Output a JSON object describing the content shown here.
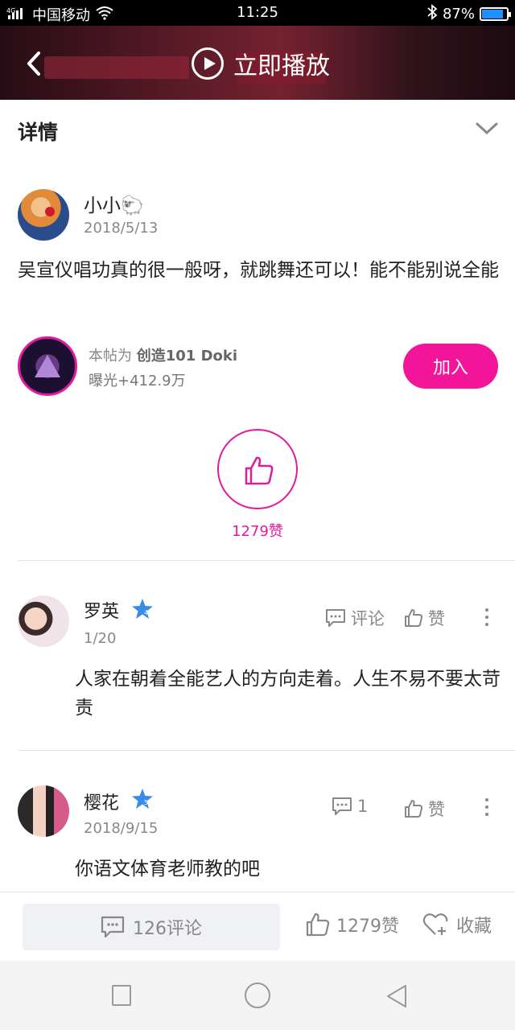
{
  "status_bar": {
    "carrier": "中国移动",
    "network": "4G",
    "time": "11:25",
    "battery": "87%",
    "battery_level": 0.87
  },
  "video": {
    "play_label": "立即播放"
  },
  "detail": {
    "title": "详情"
  },
  "post": {
    "author": "小小🐑",
    "date": "2018/5/13",
    "text": "吴宣仪唱功真的很一般呀，就跳舞还可以！能不能别说全能"
  },
  "community": {
    "prefix": "本帖为",
    "name": "创造101 Doki",
    "exposure": "曝光+412.9万",
    "join_label": "加入"
  },
  "like": {
    "count_label": "1279赞"
  },
  "comments": [
    {
      "name": "罗英",
      "date": "1/20",
      "comment_label": "评论",
      "like_label": "赞",
      "text": "人家在朝着全能艺人的方向走着。人生不易不要太苛责"
    },
    {
      "name": "樱花",
      "date": "2018/9/15",
      "comment_label": "1",
      "like_label": "赞",
      "text": "你语文体育老师教的吧"
    }
  ],
  "bottom_bar": {
    "comments_label": "126评论",
    "likes_label": "1279赞",
    "favorite_label": "收藏"
  },
  "colors": {
    "accent": "#f2159a",
    "accent_outline": "#e11aa0",
    "badge_star": "#3a8be8"
  }
}
